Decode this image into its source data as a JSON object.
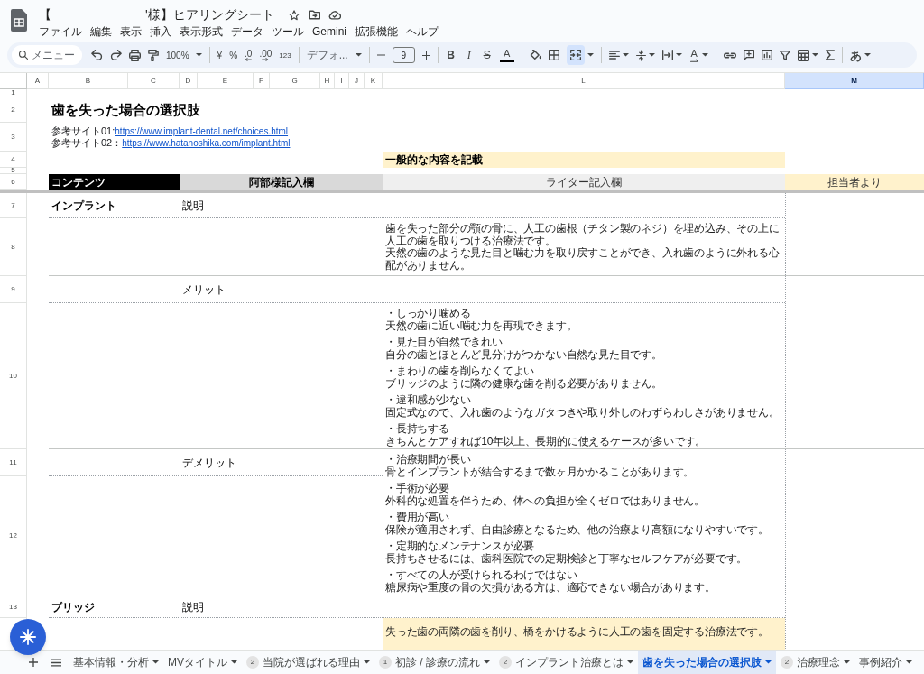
{
  "app_bar": {
    "title_start": "【",
    "title_end": "'様】ヒアリングシート",
    "starred": false,
    "menu": [
      "ファイル",
      "編集",
      "表示",
      "挿入",
      "表示形式",
      "データ",
      "ツール",
      "Gemini",
      "拡張機能",
      "ヘルプ"
    ]
  },
  "toolbar": {
    "search": {
      "placeholder": "メニュー"
    },
    "zoom": "100%",
    "number_formats": [
      "¥",
      "%",
      ".0",
      ".00",
      "123"
    ],
    "font": "デフォ...",
    "font_size": "9",
    "text_styles": [
      "B",
      "I",
      "S",
      "A"
    ],
    "merge_active": true,
    "text_rotation": "A",
    "input_tool": "あ"
  },
  "sheet": {
    "columns": [
      {
        "label": "A",
        "selected": false
      },
      {
        "label": "B",
        "selected": false
      },
      {
        "label": "C",
        "selected": false
      },
      {
        "label": "D",
        "selected": false
      },
      {
        "label": "E",
        "selected": false
      },
      {
        "label": "F",
        "selected": false
      },
      {
        "label": "G",
        "selected": false
      },
      {
        "label": "H",
        "selected": false
      },
      {
        "label": "I",
        "selected": false
      },
      {
        "label": "J",
        "selected": false
      },
      {
        "label": "K",
        "selected": false
      },
      {
        "label": "L",
        "selected": false
      },
      {
        "label": "M",
        "selected": true
      }
    ],
    "row_numbers": [
      "1",
      "2",
      "3",
      "4",
      "5",
      "6",
      "7",
      "8",
      "9",
      "10",
      "11",
      "12",
      "13"
    ],
    "title": "歯を失った場合の選択肢",
    "references": [
      {
        "text": "参考サイト01:",
        "link": "https://www.implant-dental.net/choices.html"
      },
      {
        "text": "参考サイト02：",
        "link": "https://www.hatanoshika.com/implant.html"
      }
    ],
    "note": "一般的な内容を記載",
    "header": [
      "コンテンツ",
      "阿部様記入欄",
      "ライター記入欄",
      "担当者より"
    ],
    "sections": [
      {
        "name": "インプラント",
        "items": [
          {
            "kind": "split",
            "label": "説明",
            "highlighted": false,
            "writer_blocks": [
              {
                "lines": [
                  "歯を失った部分の顎の骨に、人工の歯根（チタン製のネジ）を埋め込み、その上に人工の歯を取りつける治療法です。",
                  "天然の歯のような見た目と噛む力を取り戻すことができ、入れ歯のように外れる心配がありません。"
                ]
              }
            ]
          },
          {
            "kind": "split",
            "label": "メリット",
            "highlighted": false,
            "writer_blocks": [
              {
                "lines": [
                  "・しっかり噛める",
                  "天然の歯に近い噛む力を再現できます。"
                ]
              },
              {
                "lines": [
                  "・見た目が自然できれい",
                  "自分の歯とほとんど見分けがつかない自然な見た目です。"
                ]
              },
              {
                "lines": [
                  "・まわりの歯を削らなくてよい",
                  "ブリッジのように隣の健康な歯を削る必要がありません。"
                ]
              },
              {
                "lines": [
                  "・違和感が少ない",
                  "固定式なので、入れ歯のようなガタつきや取り外しのわずらわしさがありません。"
                ]
              },
              {
                "lines": [
                  "・長持ちする",
                  "きちんとケアすれば10年以上、長期的に使えるケースが多いです。"
                ]
              }
            ]
          },
          {
            "kind": "merged",
            "label": "デメリット",
            "highlighted": false,
            "writer_blocks": [
              {
                "lines": [
                  "・治療期間が長い",
                  "骨とインプラントが結合するまで数ヶ月かかることがあります。"
                ]
              },
              {
                "lines": [
                  "・手術が必要",
                  "外科的な処置を伴うため、体への負担が全くゼロではありません。"
                ]
              },
              {
                "lines": [
                  "・費用が高い",
                  "保険が適用されず、自由診療となるため、他の治療より高額になりやすいです。"
                ]
              },
              {
                "lines": [
                  "・定期的なメンテナンスが必要",
                  "長持ちさせるには、歯科医院での定期検診と丁寧なセルフケアが必要です。"
                ]
              },
              {
                "lines": [
                  "・すべての人が受けられるわけではない",
                  "糖尿病や重度の骨の欠損がある方は、適応できない場合があります。"
                ]
              }
            ]
          }
        ]
      },
      {
        "name": "ブリッジ",
        "items": [
          {
            "kind": "split",
            "label": "説明",
            "highlighted": true,
            "writer_blocks": [
              {
                "lines": [
                  "失った歯の両隣の歯を削り、橋をかけるように人工の歯を固定する治療法です。"
                ]
              }
            ]
          }
        ]
      }
    ]
  },
  "sheet_tabs": [
    {
      "label": "基本情報・分析",
      "selected": false
    },
    {
      "label": "MVタイトル",
      "selected": false
    },
    {
      "badge": "2",
      "label": "当院が選ばれる理由",
      "selected": false
    },
    {
      "badge": "1",
      "label": "初診 / 診療の流れ",
      "selected": false
    },
    {
      "badge": "2",
      "label": "インプラント治療とは",
      "selected": false
    },
    {
      "label": "歯を失った場合の選択肢",
      "selected": true
    },
    {
      "badge": "2",
      "label": "治療理念",
      "selected": false
    },
    {
      "label": "事例紹介",
      "selected": false
    }
  ]
}
